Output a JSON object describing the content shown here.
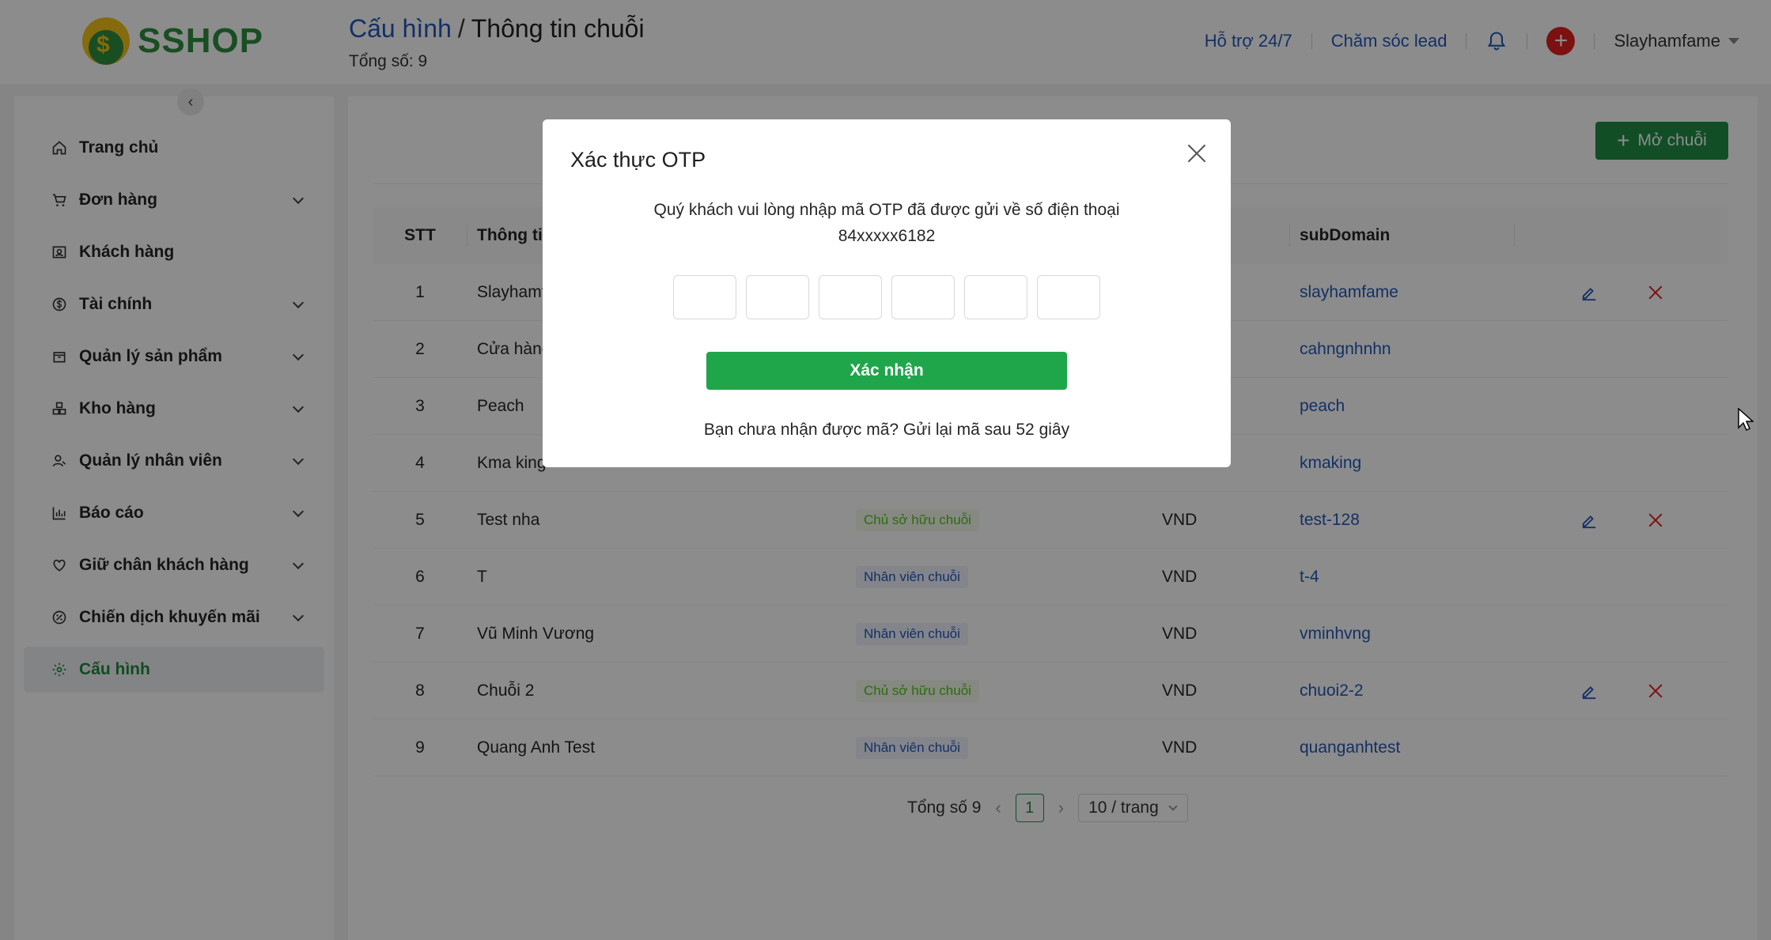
{
  "header": {
    "logo_text": "SSHOP",
    "logo_glyph": "$",
    "breadcrumb_link": "Cấu hình",
    "breadcrumb_sep": "/",
    "breadcrumb_current": "Thông tin chuỗi",
    "total": "Tổng số: 9",
    "support": "Hỗ trợ 24/7",
    "lead_care": "Chăm sóc lead",
    "username": "Slayhamfame"
  },
  "sidebar": {
    "collapse_glyph": "‹",
    "items": [
      {
        "label": "Trang chủ",
        "icon": "home-icon"
      },
      {
        "label": "Đơn hàng",
        "icon": "cart-icon"
      },
      {
        "label": "Khách hàng",
        "icon": "contact-icon"
      },
      {
        "label": "Tài chính",
        "icon": "dollar-icon"
      },
      {
        "label": "Quản lý sản phẩm",
        "icon": "box-icon"
      },
      {
        "label": "Kho hàng",
        "icon": "warehouse-icon"
      },
      {
        "label": "Quản lý nhân viên",
        "icon": "staff-icon"
      },
      {
        "label": "Báo cáo",
        "icon": "chart-icon"
      },
      {
        "label": "Giữ chân khách hàng",
        "icon": "heart-icon"
      },
      {
        "label": "Chiến dịch khuyến mãi",
        "icon": "discount-icon"
      },
      {
        "label": "Cấu hình",
        "icon": "gear-icon"
      }
    ]
  },
  "main": {
    "open_button": "Mở chuỗi",
    "columns": {
      "stt": "STT",
      "info": "Thông tin",
      "subdomain": "subDomain"
    },
    "rows": [
      {
        "stt": "1",
        "name": "Slayhamf",
        "role": "",
        "role_type": "",
        "currency": "",
        "sub": "slayhamfame",
        "actions": true
      },
      {
        "stt": "2",
        "name": "Cửa hàng",
        "role": "",
        "role_type": "",
        "currency": "",
        "sub": "cahngnhnhn",
        "actions": false
      },
      {
        "stt": "3",
        "name": "Peach",
        "role": "",
        "role_type": "",
        "currency": "",
        "sub": "peach",
        "actions": false
      },
      {
        "stt": "4",
        "name": "Kma king",
        "role": "",
        "role_type": "",
        "currency": "",
        "sub": "kmaking",
        "actions": false
      },
      {
        "stt": "5",
        "name": "Test nha",
        "role": "Chủ sở hữu chuỗi",
        "role_type": "owner",
        "currency": "VND",
        "sub": "test-128",
        "actions": true
      },
      {
        "stt": "6",
        "name": "T",
        "role": "Nhân viên chuỗi",
        "role_type": "staff",
        "currency": "VND",
        "sub": "t-4",
        "actions": false
      },
      {
        "stt": "7",
        "name": "Vũ Minh Vương",
        "role": "Nhân viên chuỗi",
        "role_type": "staff",
        "currency": "VND",
        "sub": "vminhvng",
        "actions": false
      },
      {
        "stt": "8",
        "name": "Chuỗi 2",
        "role": "Chủ sở hữu chuỗi",
        "role_type": "owner",
        "currency": "VND",
        "sub": "chuoi2-2",
        "actions": true
      },
      {
        "stt": "9",
        "name": "Quang Anh Test",
        "role": "Nhân viên chuỗi",
        "role_type": "staff",
        "currency": "VND",
        "sub": "quanganhtest",
        "actions": false
      }
    ],
    "pagination": {
      "total": "Tổng số 9",
      "prev": "‹",
      "page": "1",
      "next": "›",
      "page_size": "10 / trang"
    }
  },
  "modal": {
    "title": "Xác thực OTP",
    "message_line1": "Quý khách vui lòng nhập mã OTP đã được gửi về số điện thoại",
    "message_line2": "84xxxxx6182",
    "confirm": "Xác nhận",
    "resend": "Bạn chưa nhận được mã? Gửi lại mã sau 52 giây"
  }
}
